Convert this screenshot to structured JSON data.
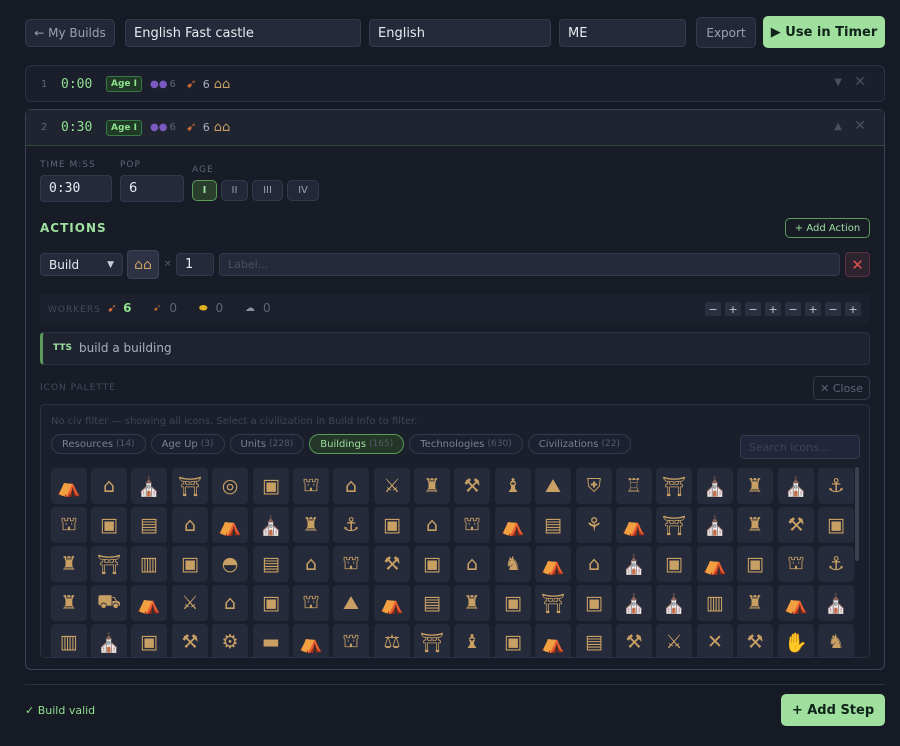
{
  "header": {
    "back_label": "← My Builds",
    "build_name": "English Fast castle",
    "civ": "English",
    "author": "ME",
    "export_label": "Export",
    "use_in_timer_label": "▶ Use in Timer"
  },
  "steps": [
    {
      "index": "1",
      "time": "0:00",
      "age": "Age I",
      "vils": "6",
      "vils_icon": "villager-icon",
      "worker_icon": "food-icon",
      "worker_count": "6",
      "building_icon": "house-icon"
    },
    {
      "index": "2",
      "time": "0:30",
      "age": "Age I",
      "vils": "6",
      "vils_icon": "villager-icon",
      "worker_icon": "food-icon",
      "worker_count": "6",
      "building_icon": "house-icon"
    }
  ],
  "editor": {
    "time_label": "TIME M:SS",
    "time_value": "0:30",
    "pop_label": "POP",
    "pop_value": "6",
    "age_label": "AGE",
    "ages": [
      "I",
      "II",
      "III",
      "IV"
    ],
    "age_selected": "I",
    "actions_label": "ACTIONS",
    "add_action_label": "+ Add Action",
    "action": {
      "type": "Build",
      "type_options": [
        "Build"
      ],
      "qty": "1",
      "label_placeholder": "Label...",
      "icon": "house-icon"
    },
    "workers_label": "WORKERS",
    "workers": [
      {
        "icon": "food-icon",
        "count": "6"
      },
      {
        "icon": "wood-icon",
        "count": "0"
      },
      {
        "icon": "gold-icon",
        "count": "0"
      },
      {
        "icon": "stone-icon",
        "count": "0"
      }
    ],
    "tts_label": "TTS",
    "tts_text": "build a building",
    "palette_label": "ICON PALETTE",
    "close_label": "✕ Close",
    "palette_hint": "No civ filter — showing all icons. Select a civilization in Build Info to filter.",
    "categories": [
      {
        "name": "Resources",
        "count": "(14)"
      },
      {
        "name": "Age Up",
        "count": "(3)"
      },
      {
        "name": "Units",
        "count": "(228)"
      },
      {
        "name": "Buildings",
        "count": "(165)"
      },
      {
        "name": "Technologies",
        "count": "(630)"
      },
      {
        "name": "Civilizations",
        "count": "(22)"
      }
    ],
    "active_category": "Buildings",
    "search_placeholder": "Search icons..."
  },
  "footer": {
    "status": "✓ Build valid",
    "add_step_label": "+ Add Step"
  },
  "colors": {
    "bg": "#161a24",
    "accent": "#9fe09f",
    "gold": "#c9a064",
    "danger": "#e05050"
  }
}
